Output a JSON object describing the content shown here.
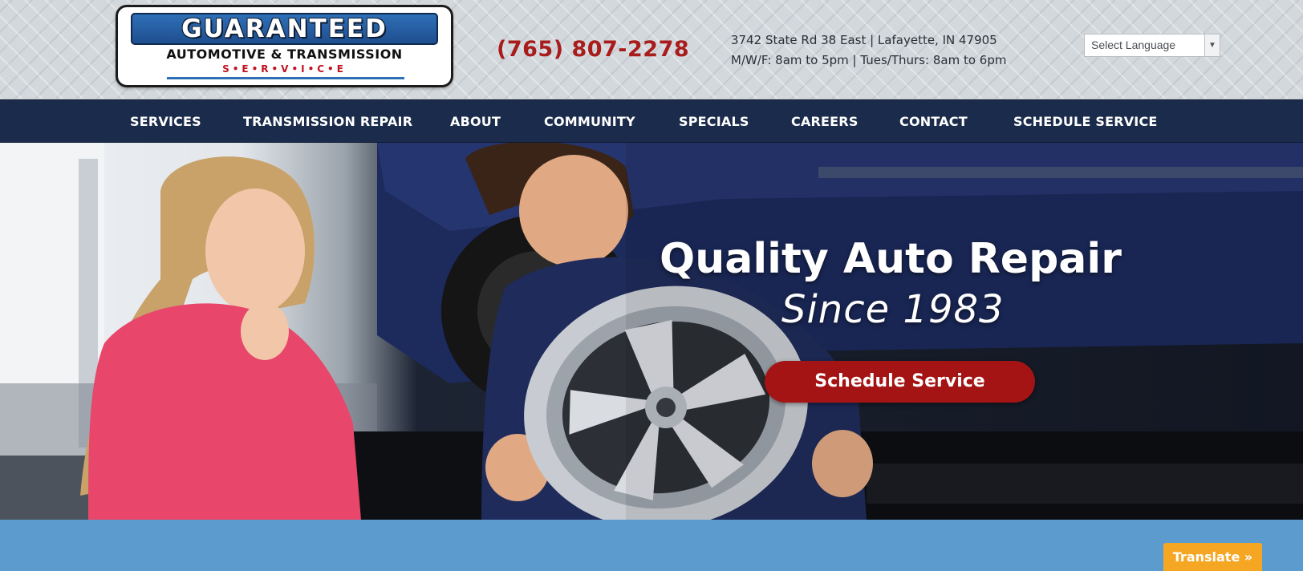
{
  "header": {
    "logo": {
      "main": "GUARANTEED",
      "sub": "AUTOMOTIVE & TRANSMISSION",
      "tagline": "S•E•R•V•I•C•E"
    },
    "phone": "(765) 807-2278",
    "address": "3742 State Rd 38 East | Lafayette, IN 47905",
    "hours": "M/W/F: 8am to 5pm | Tues/Thurs: 8am to 6pm",
    "language_select": {
      "selected": "Select Language",
      "arrow_icon": "chevron-down-icon"
    }
  },
  "nav": {
    "items": [
      {
        "label": "SERVICES"
      },
      {
        "label": "TRANSMISSION REPAIR"
      },
      {
        "label": "ABOUT"
      },
      {
        "label": "COMMUNITY"
      },
      {
        "label": "SPECIALS"
      },
      {
        "label": "CAREERS"
      },
      {
        "label": "CONTACT"
      },
      {
        "label": "SCHEDULE SERVICE"
      }
    ]
  },
  "hero": {
    "title": "Quality Auto Repair",
    "subtitle": "Since 1983",
    "cta_label": "Schedule Service"
  },
  "translate": {
    "label": "Translate »"
  },
  "colors": {
    "nav_background": "#1b2b4c",
    "phone": "#a81c1c",
    "cta": "#a51414",
    "band": "#5c9bce",
    "translate_button": "#f5a623",
    "logo_blue": "#2f6fb6"
  }
}
